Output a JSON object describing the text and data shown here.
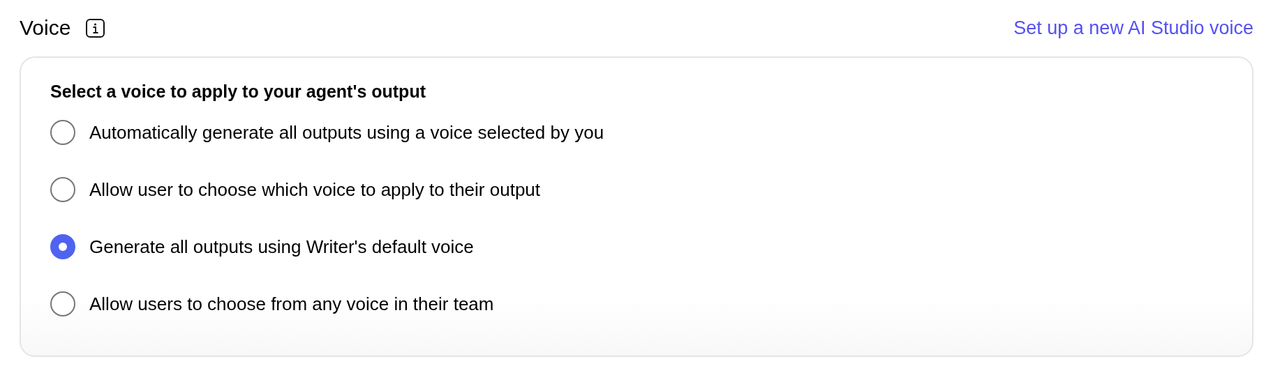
{
  "title": "Voice",
  "link": "Set up a new AI Studio voice",
  "card": {
    "heading": "Select a voice to apply to your agent's output",
    "options": [
      {
        "label": "Automatically generate all outputs using a voice selected by you",
        "selected": false
      },
      {
        "label": "Allow user to choose which voice to apply to their output",
        "selected": false
      },
      {
        "label": "Generate all outputs using Writer's default voice",
        "selected": true
      },
      {
        "label": "Allow users to choose from any voice in their team",
        "selected": false
      }
    ]
  }
}
